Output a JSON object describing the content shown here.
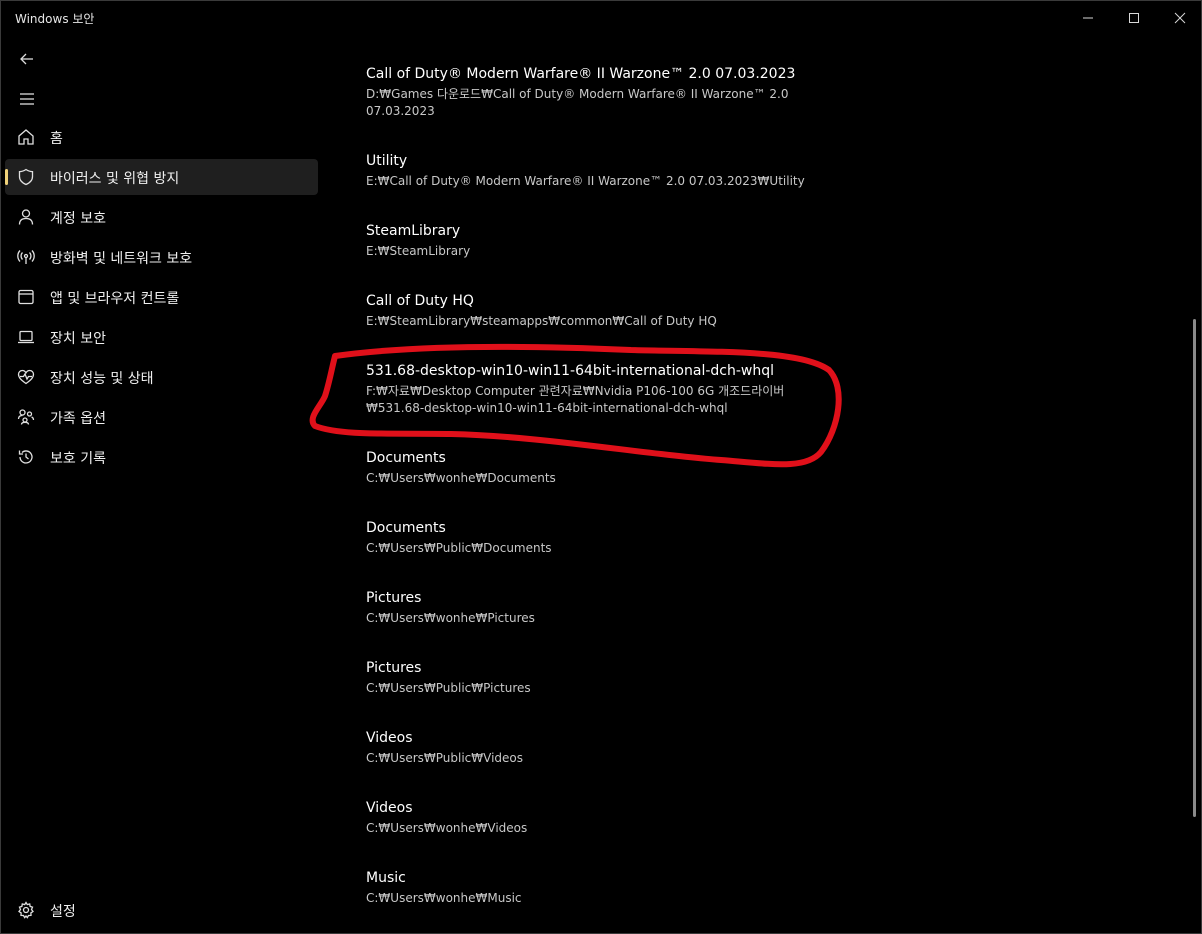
{
  "window": {
    "title": "Windows 보안"
  },
  "icons": {
    "back": "back-arrow-icon",
    "menu": "hamburger-menu-icon",
    "settings": "gear-icon"
  },
  "sidebar": {
    "items": [
      {
        "label": "홈",
        "icon": "home-icon"
      },
      {
        "label": "바이러스 및 위협 방지",
        "icon": "shield-icon",
        "active": true
      },
      {
        "label": "계정 보호",
        "icon": "person-icon"
      },
      {
        "label": "방화벽 및 네트워크 보호",
        "icon": "antenna-icon"
      },
      {
        "label": "앱 및 브라우저 컨트롤",
        "icon": "browser-window-icon"
      },
      {
        "label": "장치 보안",
        "icon": "laptop-icon"
      },
      {
        "label": "장치 성능 및 상태",
        "icon": "heart-pulse-icon"
      },
      {
        "label": "가족 옵션",
        "icon": "family-icon"
      },
      {
        "label": "보호 기록",
        "icon": "history-icon"
      }
    ],
    "settings_label": "설정"
  },
  "exclusions": [
    {
      "name": "Call of Duty® Modern Warfare® II  Warzone™ 2.0  07.03.2023",
      "path": "D:₩Games 다운로드₩Call of Duty® Modern Warfare® II  Warzone™ 2.0 07.03.2023"
    },
    {
      "name": "Utility",
      "path": "E:₩Call of Duty® Modern Warfare® II  Warzone™ 2.0  07.03.2023₩Utility"
    },
    {
      "name": "SteamLibrary",
      "path": "E:₩SteamLibrary"
    },
    {
      "name": "Call of Duty HQ",
      "path": "E:₩SteamLibrary₩steamapps₩common₩Call of Duty HQ"
    },
    {
      "name": "531.68-desktop-win10-win11-64bit-international-dch-whql",
      "path": "F:₩자료₩Desktop Computer 관련자료₩Nvidia P106-100 6G 개조드라이버 ₩531.68-desktop-win10-win11-64bit-international-dch-whql"
    },
    {
      "name": "Documents",
      "path": "C:₩Users₩wonhe₩Documents"
    },
    {
      "name": "Documents",
      "path": "C:₩Users₩Public₩Documents"
    },
    {
      "name": "Pictures",
      "path": "C:₩Users₩wonhe₩Pictures"
    },
    {
      "name": "Pictures",
      "path": "C:₩Users₩Public₩Pictures"
    },
    {
      "name": "Videos",
      "path": "C:₩Users₩Public₩Videos"
    },
    {
      "name": "Videos",
      "path": "C:₩Users₩wonhe₩Videos"
    },
    {
      "name": "Music",
      "path": "C:₩Users₩wonhe₩Music"
    }
  ],
  "colors": {
    "background": "#000000",
    "active_indicator": "#f0d27a",
    "annotation": "#e0101a"
  }
}
